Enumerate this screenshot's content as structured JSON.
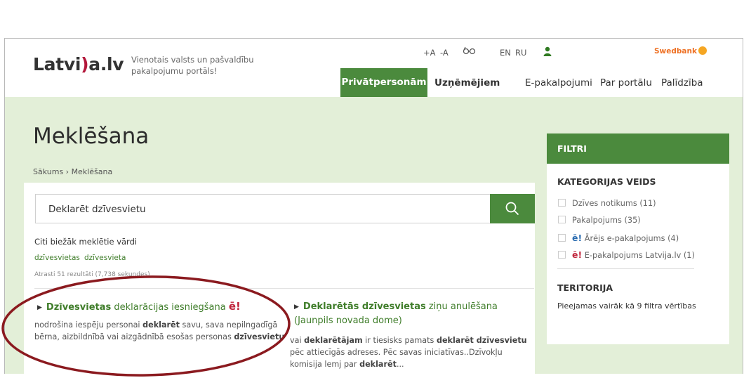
{
  "header": {
    "logo": "Latvija.lv",
    "tagline": "Vienotais valsts un pašvaldību pakalpojumu portāls!",
    "font_plus": "+A",
    "font_minus": "-A",
    "lang_en": "EN",
    "lang_ru": "RU",
    "swedbank": "Swedbank"
  },
  "nav": {
    "private": "Privātpersonām",
    "business": "Uzņēmējiem",
    "eservices": "E-pakalpojumi",
    "about": "Par portālu",
    "help": "Palīdzība"
  },
  "page": {
    "title": "Meklēšana",
    "breadcrumb": "Sākums › Meklēšana"
  },
  "search": {
    "value": "Deklarēt dzīvesvietu"
  },
  "frequent": {
    "title": "Citi biežāk meklētie vārdi",
    "term1": "dzīvesvietas",
    "term2": "dzīvesvieta"
  },
  "found": "Atrasti 51 rezultāti (7,738 sekundes)",
  "results": [
    {
      "title_bold": "Dzīvesvietas",
      "title_rest": " deklarācijas iesniegšana",
      "badge": "ē!",
      "desc_1": "nodrošina iespēju personai ",
      "desc_b1": "deklarēt",
      "desc_2": " savu, sava nepilngadīgā bērna, aizbildnībā vai aizgādnībā esošas personas ",
      "desc_b2": "dzīvesvietu"
    },
    {
      "title_bold": "Deklarētās dzīvesvietas",
      "title_rest": " ziņu anulēšana (Jaunpils novada dome)",
      "desc_1": "vai ",
      "desc_b1": "deklarētājam",
      "desc_2": " ir tiesisks pamats ",
      "desc_b2": "deklarēt dzīvesvietu",
      "desc_3": " pēc attiecīgās adreses. Pēc savas iniciatīvas..Dzīvokļu komisija lemj par ",
      "desc_b3": "deklarēt",
      "desc_4": "..."
    }
  ],
  "filters": {
    "header": "FILTRI",
    "category_title": "KATEGORIJAS VEIDS",
    "options": [
      {
        "label": "Dzīves notikums (11)"
      },
      {
        "label": "Pakalpojums (35)"
      },
      {
        "badge": "ē!",
        "label": "Ārējs e-pakalpojums (4)"
      },
      {
        "badge": "ē!",
        "label": "E-pakalpojums Latvija.lv (1)"
      }
    ],
    "territory_title": "TERITORIJA",
    "more": "Pieejamas vairāk kā 9 filtra vērtības"
  },
  "colors": {
    "brand_green": "#4b8a3d",
    "hero_bg": "#e3efd8",
    "link_green": "#3f7d2a",
    "annotation_oval": "#8b1a1f"
  }
}
